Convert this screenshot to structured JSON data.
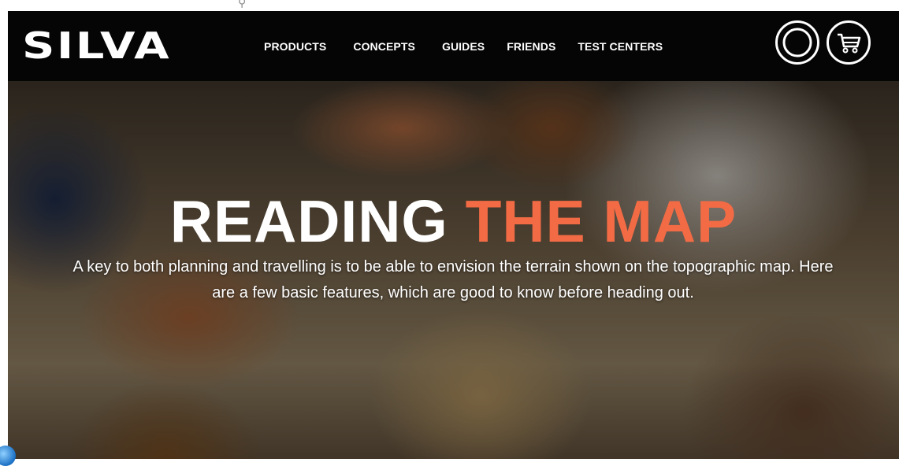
{
  "brand": {
    "logo_text": "SILVA"
  },
  "nav": {
    "items": [
      {
        "label": "PRODUCTS"
      },
      {
        "label": "CONCEPTS"
      },
      {
        "label": "GUIDES"
      },
      {
        "label": "FRIENDS"
      },
      {
        "label": "TEST CENTERS"
      }
    ],
    "search_icon": "search-icon",
    "cart_icon": "cart-icon"
  },
  "hero": {
    "title_part1": "READING",
    "title_part2": "THE MAP",
    "subtitle": "A key to both planning and travelling is to be able to envision the terrain shown on the topographic map. Here are a few basic features, which are good to know before heading out."
  },
  "colors": {
    "nav_background": "#050505",
    "accent": "#f26b45",
    "text_light": "#ffffff"
  }
}
